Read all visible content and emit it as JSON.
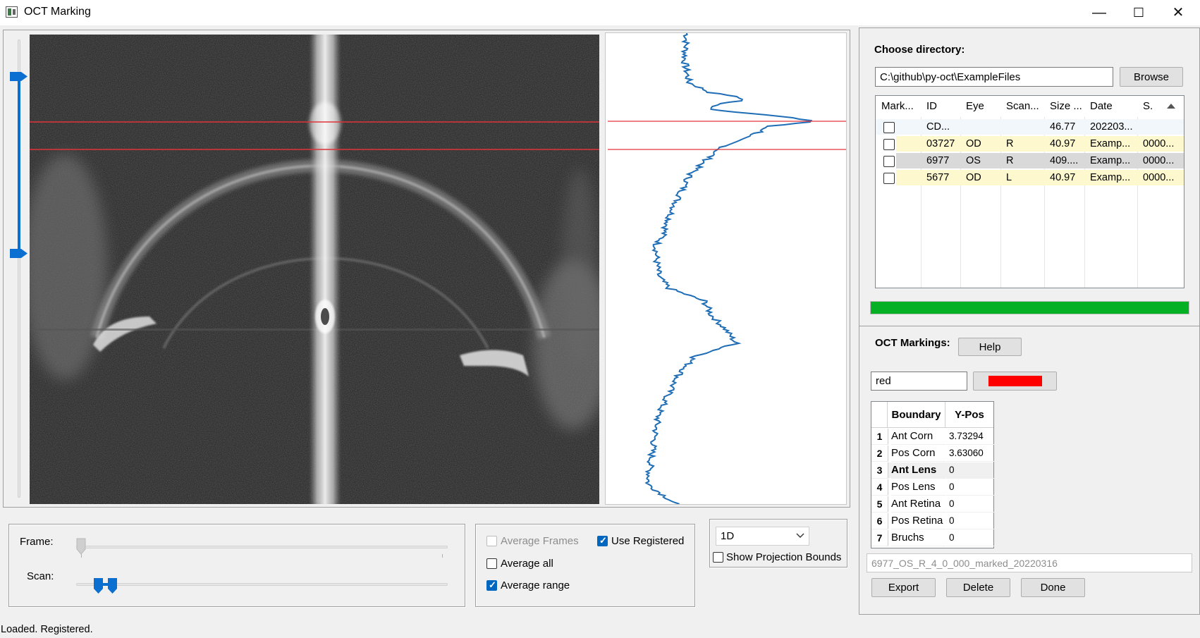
{
  "window": {
    "title": "OCT Marking",
    "minimize_glyph": "—",
    "maximize_glyph": "☐",
    "close_glyph": "✕"
  },
  "controls": {
    "frame_label": "Frame:",
    "scan_label": "Scan:",
    "average_frames": "Average Frames",
    "average_frames_checked": false,
    "use_registered": "Use Registered",
    "use_registered_checked": true,
    "average_all": "Average all",
    "average_all_checked": false,
    "average_range": "Average range",
    "average_range_checked": true,
    "mode_select": "1D",
    "show_projection_bounds": "Show Projection Bounds",
    "show_projection_bounds_checked": false
  },
  "directory": {
    "label": "Choose directory:",
    "path": "C:\\github\\py-oct\\ExampleFiles",
    "browse_label": "Browse",
    "columns": [
      "Mark...",
      "ID",
      "Eye",
      "Scan...",
      "Size ...",
      "Date",
      "S."
    ],
    "rows": [
      {
        "id": "CD...",
        "eye": "",
        "scan": "",
        "size": "46.77",
        "date": "202203...",
        "s": ""
      },
      {
        "id": "03727",
        "eye": "OD",
        "scan": "R",
        "size": "40.97",
        "date": "Examp...",
        "s": "0000..."
      },
      {
        "id": "6977",
        "eye": "OS",
        "scan": "R",
        "size": "409....",
        "date": "Examp...",
        "s": "0000..."
      },
      {
        "id": "5677",
        "eye": "OD",
        "scan": "L",
        "size": "40.97",
        "date": "Examp...",
        "s": "0000..."
      }
    ],
    "progress": 1.0,
    "progress_color": "#06b025"
  },
  "markings": {
    "label": "OCT Markings:",
    "help_label": "Help",
    "color_name": "red",
    "color_swatch": "#ff0000",
    "columns": [
      "Boundary",
      "Y-Pos"
    ],
    "rows": [
      {
        "num": "1",
        "boundary": "Ant Corn",
        "ypos": "3.73294"
      },
      {
        "num": "2",
        "boundary": "Pos Corn",
        "ypos": "3.63060"
      },
      {
        "num": "3",
        "boundary": "Ant Lens",
        "ypos": "0"
      },
      {
        "num": "4",
        "boundary": "Pos Lens",
        "ypos": "0"
      },
      {
        "num": "5",
        "boundary": "Ant Retina",
        "ypos": "0"
      },
      {
        "num": "6",
        "boundary": "Pos Retina",
        "ypos": "0"
      },
      {
        "num": "7",
        "boundary": "Bruchs",
        "ypos": "0"
      }
    ],
    "filename_placeholder": "6977_OS_R_4_0_000_marked_20220316",
    "export_label": "Export",
    "delete_label": "Delete",
    "done_label": "Done"
  },
  "status": "Loaded. Registered.",
  "colors": {
    "marker_line": "#e0343a",
    "profile_line": "#1f6db5",
    "slider_handle": "#0a6fd1"
  }
}
